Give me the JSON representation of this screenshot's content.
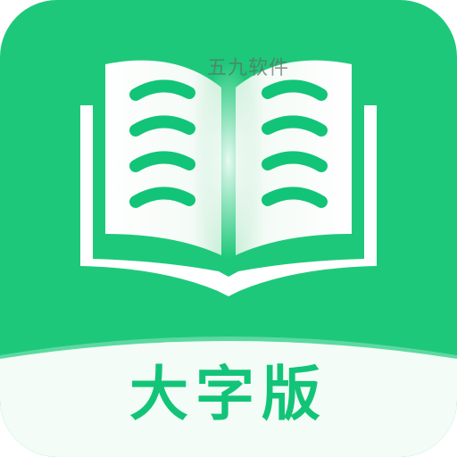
{
  "app_icon": {
    "label": "大字版",
    "watermark": "五九软件",
    "icon_name": "open-book-icon",
    "colors": {
      "background": "#1ec87a",
      "book": "#ffffff",
      "accent": "#12c478",
      "label_band": "#f3fcf6"
    }
  }
}
